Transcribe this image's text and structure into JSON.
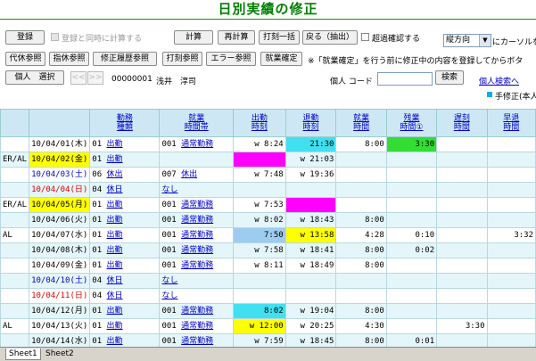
{
  "page": {
    "title": "日別実績の修正"
  },
  "toolbar1": {
    "register": "登録",
    "calc_on_register": "登録と同時に計算する",
    "calc": "計算",
    "recalc": "再計算",
    "stamp_batch": "打刻一括",
    "back_extract": "戻る（抽出）",
    "overtime_check": "超過確認する",
    "direction_select": "縦方向",
    "cursor_label": "にカーソルを"
  },
  "toolbar2": {
    "substitute_ref": "代休参照",
    "designated_ref": "指休参照",
    "history_ref": "修正履歴参照",
    "stamp_ref": "打刻参照",
    "error_ref": "エラー参照",
    "confirm": "就業確定",
    "note": "※「就業確定」を行う前に修正中の内容を登録してからボタ"
  },
  "toolbar3": {
    "select_person": "個人　選択",
    "prev": "<<",
    "next": ">>",
    "emp_code": "00000001",
    "emp_name": "浅井　淳司",
    "code_label": "個人 コード",
    "search": "検索",
    "person_search": "個人検索へ"
  },
  "legend": {
    "manual": "手修正(本人"
  },
  "table": {
    "headers": [
      "",
      "",
      "勤務\n種類",
      "就業\n時間帯",
      "出勤\n時刻",
      "退勤\n時刻",
      "就業\n時間",
      "残業\n時間①",
      "遅刻\n時間",
      "早退\n時間"
    ],
    "rows": [
      {
        "pre": "",
        "date": "10/04/01(木)",
        "kc": "01",
        "kind": "出勤",
        "tc": "001",
        "tzone": "通常勤務",
        "in": "w 8:24",
        "out": "21:30",
        "work": "8:00",
        "ot": "3:30",
        "late": "",
        "early": ""
      },
      {
        "pre": "ER/AL",
        "date": "10/04/02(金)",
        "kc": "01",
        "kind": "出勤",
        "tc": "",
        "tzone": "",
        "in": "",
        "out": "w 21:03",
        "work": "",
        "ot": "",
        "late": "",
        "early": ""
      },
      {
        "pre": "",
        "date": "10/04/03(土)",
        "kc": "06",
        "kind": "休出",
        "tc": "007",
        "tzone": "休出",
        "in": "w 7:48",
        "out": "w 19:36",
        "work": "",
        "ot": "",
        "late": "",
        "early": ""
      },
      {
        "pre": "",
        "date": "10/04/04(日)",
        "kc": "04",
        "kind": "休日",
        "tc": "",
        "tzone": "なし",
        "in": "",
        "out": "",
        "work": "",
        "ot": "",
        "late": "",
        "early": ""
      },
      {
        "pre": "ER/AL",
        "date": "10/04/05(月)",
        "kc": "01",
        "kind": "出勤",
        "tc": "001",
        "tzone": "通常勤務",
        "in": "w 7:53",
        "out": "",
        "work": "",
        "ot": "",
        "late": "",
        "early": ""
      },
      {
        "pre": "",
        "date": "10/04/06(火)",
        "kc": "01",
        "kind": "出勤",
        "tc": "001",
        "tzone": "通常勤務",
        "in": "w 8:02",
        "out": "w 18:43",
        "work": "8:00",
        "ot": "",
        "late": "",
        "early": ""
      },
      {
        "pre": "AL",
        "date": "10/04/07(水)",
        "kc": "01",
        "kind": "出勤",
        "tc": "001",
        "tzone": "通常勤務",
        "in": "7:50",
        "out": "w 13:58",
        "work": "4:28",
        "ot": "0:10",
        "late": "",
        "early": "3:32"
      },
      {
        "pre": "",
        "date": "10/04/08(木)",
        "kc": "01",
        "kind": "出勤",
        "tc": "001",
        "tzone": "通常勤務",
        "in": "w 7:58",
        "out": "w 18:41",
        "work": "8:00",
        "ot": "0:02",
        "late": "",
        "early": ""
      },
      {
        "pre": "",
        "date": "10/04/09(金)",
        "kc": "01",
        "kind": "出勤",
        "tc": "001",
        "tzone": "通常勤務",
        "in": "w 8:11",
        "out": "w 18:49",
        "work": "8:00",
        "ot": "",
        "late": "",
        "early": ""
      },
      {
        "pre": "",
        "date": "10/04/10(土)",
        "kc": "04",
        "kind": "休日",
        "tc": "",
        "tzone": "なし",
        "in": "",
        "out": "",
        "work": "",
        "ot": "",
        "late": "",
        "early": ""
      },
      {
        "pre": "",
        "date": "10/04/11(日)",
        "kc": "04",
        "kind": "休日",
        "tc": "",
        "tzone": "なし",
        "in": "",
        "out": "",
        "work": "",
        "ot": "",
        "late": "",
        "early": ""
      },
      {
        "pre": "",
        "date": "10/04/12(月)",
        "kc": "01",
        "kind": "出勤",
        "tc": "001",
        "tzone": "通常勤務",
        "in": "8:02",
        "out": "w 19:04",
        "work": "8:00",
        "ot": "",
        "late": "",
        "early": ""
      },
      {
        "pre": "AL",
        "date": "10/04/13(火)",
        "kc": "01",
        "kind": "出勤",
        "tc": "001",
        "tzone": "通常勤務",
        "in": "w 12:00",
        "out": "w 20:25",
        "work": "4:30",
        "ot": "",
        "late": "3:30",
        "early": ""
      },
      {
        "pre": "",
        "date": "10/04/14(水)",
        "kc": "01",
        "kind": "出勤",
        "tc": "001",
        "tzone": "通常勤務",
        "in": "w 7:59",
        "out": "w 18:45",
        "work": "8:00",
        "ot": "0:01",
        "late": "",
        "early": ""
      }
    ]
  },
  "sheets": [
    "Sheet1",
    "Sheet2"
  ],
  "colors": {
    "title": "#008000",
    "header_bg": "#cde8f4",
    "alt_row": "#e4f6f9",
    "highlight_yellow": "#ffff00",
    "highlight_cyan": "#40e0f0",
    "highlight_magenta": "#ff00ff",
    "highlight_green": "#33dd33",
    "saturday_blue": "#0000cc",
    "sunday_red": "#e00000"
  }
}
